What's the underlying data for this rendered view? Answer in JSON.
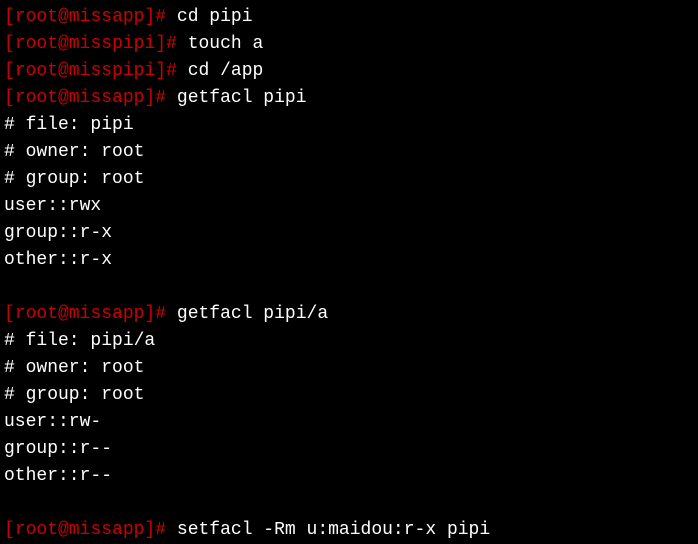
{
  "prompts": {
    "p0": {
      "open": "[",
      "user": "root",
      "at": "@",
      "host": "miss",
      "path": "app",
      "close": "]",
      "hash": "#"
    },
    "p1": {
      "open": "[",
      "user": "root",
      "at": "@",
      "host": "miss",
      "path": "pipi",
      "close": "]",
      "hash": "#"
    }
  },
  "commands": {
    "c0": " cd pipi",
    "c1": " touch a",
    "c2": " cd /app",
    "c3": " getfacl pipi",
    "c4": " getfacl pipi/a",
    "c5": " setfacl -Rm u:maidou:r-x pipi"
  },
  "outputs": {
    "o0": "# file: pipi",
    "o1": "# owner: root",
    "o2": "# group: root",
    "o3": "user::rwx",
    "o4": "group::r-x",
    "o5": "other::r-x",
    "o6": "# file: pipi/a",
    "o7": "# owner: root",
    "o8": "# group: root",
    "o9": "user::rw-",
    "o10": "group::r--",
    "o11": "other::r--"
  }
}
